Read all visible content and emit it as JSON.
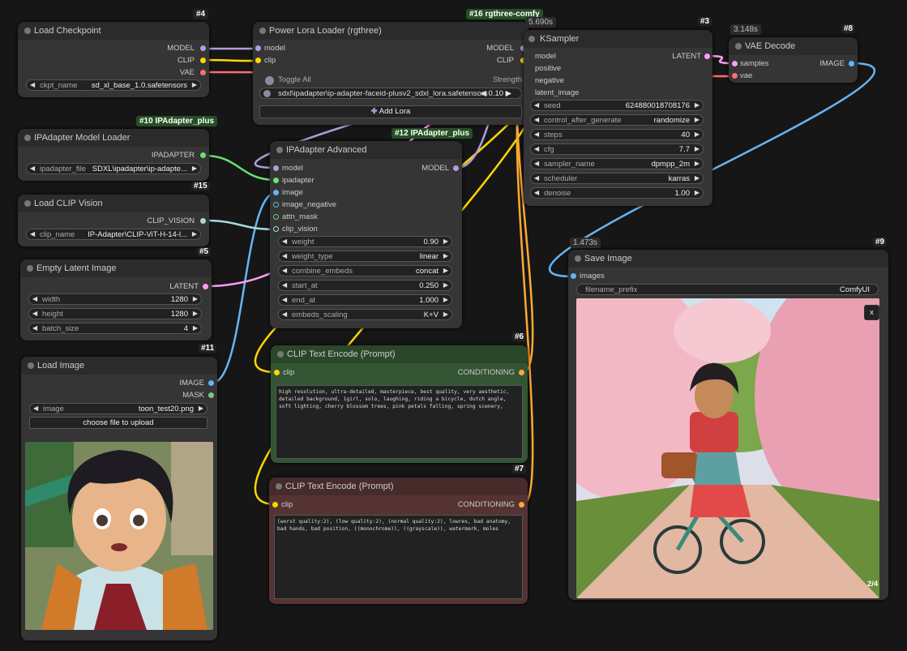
{
  "nodes": {
    "load_checkpoint": {
      "id": "#4",
      "title": "Load Checkpoint",
      "outputs": [
        "MODEL",
        "CLIP",
        "VAE"
      ],
      "widgets": [
        {
          "label": "ckpt_name",
          "value": "sd_xl_base_1.0.safetensors"
        }
      ]
    },
    "power_lora": {
      "id": "#16 rgthree-comfy",
      "title": "Power Lora Loader (rgthree)",
      "inputs": [
        "model",
        "clip"
      ],
      "outputs": [
        "MODEL",
        "CLIP"
      ],
      "toggle_all": "Toggle All",
      "strength_label": "Strength",
      "lora_name": "sdxl\\ipadapter\\ip-adapter-faceid-plusv2_sdxl_lora.safetensors",
      "lora_strength": "0.10",
      "add_lora": "Add Lora"
    },
    "ksampler": {
      "id": "#3",
      "timer": "5.690s",
      "title": "KSampler",
      "inputs": [
        "model",
        "positive",
        "negative",
        "latent_image"
      ],
      "outputs": [
        "LATENT"
      ],
      "widgets": [
        {
          "label": "seed",
          "value": "624880018708176"
        },
        {
          "label": "control_after_generate",
          "value": "randomize"
        },
        {
          "label": "steps",
          "value": "40"
        },
        {
          "label": "cfg",
          "value": "7.7"
        },
        {
          "label": "sampler_name",
          "value": "dpmpp_2m"
        },
        {
          "label": "scheduler",
          "value": "karras"
        },
        {
          "label": "denoise",
          "value": "1.00"
        }
      ]
    },
    "vae_decode": {
      "id": "#8",
      "timer": "3.148s",
      "title": "VAE Decode",
      "inputs": [
        "samples",
        "vae"
      ],
      "outputs": [
        "IMAGE"
      ]
    },
    "ipadapter_loader": {
      "id": "#10 IPAdapter_plus",
      "title": "IPAdapter Model Loader",
      "outputs": [
        "IPADAPTER"
      ],
      "widgets": [
        {
          "label": "ipadapter_file",
          "value": "SDXL\\ipadapter\\ip-adapte..."
        }
      ]
    },
    "ipadapter_adv": {
      "id": "#12 IPAdapter_plus",
      "title": "IPAdapter Advanced",
      "inputs": [
        "model",
        "ipadapter",
        "image",
        "image_negative",
        "attn_mask",
        "clip_vision"
      ],
      "outputs": [
        "MODEL"
      ],
      "widgets": [
        {
          "label": "weight",
          "value": "0.90"
        },
        {
          "label": "weight_type",
          "value": "linear"
        },
        {
          "label": "combine_embeds",
          "value": "concat"
        },
        {
          "label": "start_at",
          "value": "0.250"
        },
        {
          "label": "end_at",
          "value": "1.000"
        },
        {
          "label": "embeds_scaling",
          "value": "K+V"
        }
      ]
    },
    "clip_vision": {
      "id": "#15",
      "title": "Load CLIP Vision",
      "outputs": [
        "CLIP_VISION"
      ],
      "widgets": [
        {
          "label": "clip_name",
          "value": "IP-Adapter\\CLIP-ViT-H-14-l..."
        }
      ]
    },
    "empty_latent": {
      "id": "#5",
      "title": "Empty Latent Image",
      "outputs": [
        "LATENT"
      ],
      "widgets": [
        {
          "label": "width",
          "value": "1280"
        },
        {
          "label": "height",
          "value": "1280"
        },
        {
          "label": "batch_size",
          "value": "4"
        }
      ]
    },
    "load_image": {
      "id": "#11",
      "title": "Load Image",
      "outputs": [
        "IMAGE",
        "MASK"
      ],
      "widgets": [
        {
          "label": "image",
          "value": "toon_test20.png"
        }
      ],
      "upload": "choose file to upload"
    },
    "clip_pos": {
      "id": "#6",
      "title": "CLIP Text Encode (Prompt)",
      "inputs": [
        "clip"
      ],
      "outputs": [
        "CONDITIONING"
      ],
      "text": "high resolution, ultra-detailed, masterpiece, best quality, very aesthetic, detailed background, 1girl, solo, laughing, riding a bicycle, dutch angle, soft lighting, cherry blossom trees, pink petals falling, spring scenery,"
    },
    "clip_neg": {
      "id": "#7",
      "title": "CLIP Text Encode (Prompt)",
      "inputs": [
        "clip"
      ],
      "outputs": [
        "CONDITIONING"
      ],
      "text": "(worst quality:2), (low quality:2), (normal quality:2), lowres, bad anatomy, bad hands, bad position, ((monochrome)), ((grayscale)), watermark, moles"
    },
    "save_image": {
      "id": "#9",
      "timer": "1.473s",
      "title": "Save Image",
      "inputs": [
        "images"
      ],
      "widgets": [
        {
          "label": "filename_prefix",
          "value": "ComfyUI"
        }
      ],
      "close": "x",
      "counter": "2/4"
    }
  },
  "colors": {
    "model": "#b39ddb",
    "clip": "#ffd500",
    "vae": "#ff6e6e",
    "latent": "#ff9cf9",
    "image": "#64b5f6",
    "ipadapter": "#6ee06e",
    "clip_vision": "#a8dadc",
    "conditioning": "#ffa931",
    "mask": "#81c784",
    "positive_node": "#335533",
    "negative_node": "#553333"
  }
}
